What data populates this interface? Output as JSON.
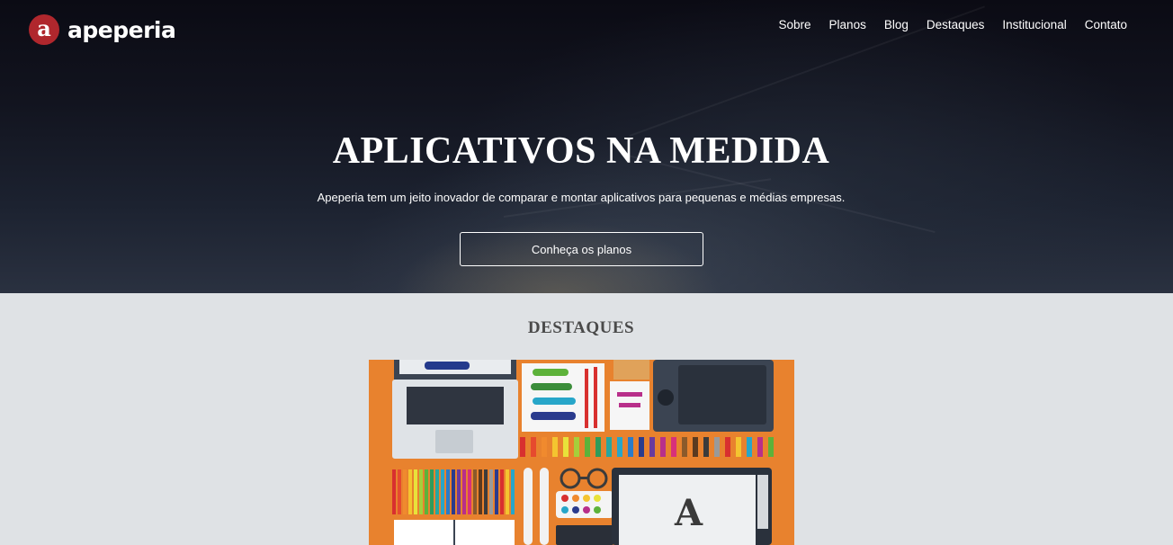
{
  "brand": {
    "logo_letter": "a",
    "name": "apeperia",
    "color": "#b0272d"
  },
  "nav": {
    "items": [
      {
        "label": "Sobre"
      },
      {
        "label": "Planos"
      },
      {
        "label": "Blog"
      },
      {
        "label": "Destaques"
      },
      {
        "label": "Institucional"
      },
      {
        "label": "Contato"
      }
    ]
  },
  "hero": {
    "title": "APLICATIVOS NA MEDIDA",
    "subtitle": "Apeperia tem um jeito inovador de comparar e montar aplicativos para pequenas e médias empresas.",
    "cta_label": "Conheça os planos"
  },
  "featured": {
    "title": "DESTAQUES",
    "image_icon": "designer-desk-illustration",
    "image_background": "#e8822e"
  }
}
